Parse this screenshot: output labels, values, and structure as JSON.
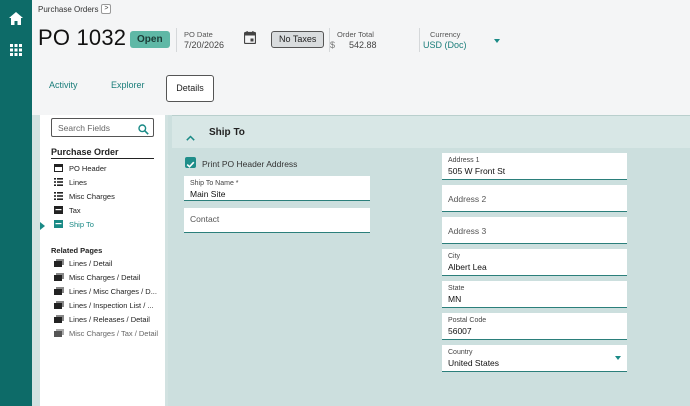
{
  "breadcrumb": {
    "label": "Purchase Orders",
    "button": ">"
  },
  "header": {
    "title": "PO 1032",
    "status": "Open",
    "po_date_label": "PO Date",
    "po_date": "7/20/2026",
    "tax_button": "No Taxes",
    "order_total_label": "Order Total",
    "currency_symbol": "$",
    "order_total": "542.88",
    "currency_label": "Currency",
    "currency_value": "USD (Doc)"
  },
  "tabs": {
    "activity": "Activity",
    "explorer": "Explorer",
    "details": "Details"
  },
  "nav": {
    "search_placeholder": "Search Fields",
    "section_title": "Purchase Order",
    "items": [
      "PO Header",
      "Lines",
      "Misc Charges",
      "Tax",
      "Ship To"
    ],
    "related_title": "Related Pages",
    "related": [
      "Lines / Detail",
      "Misc Charges / Detail",
      "Lines / Misc Charges / D...",
      "Lines / Inspection List / ...",
      "Lines / Releases / Detail",
      "Misc Charges / Tax / Detail"
    ]
  },
  "ship_to": {
    "section_title": "Ship To",
    "print_header_label": "Print PO Header Address",
    "ship_to_name_label": "Ship To Name *",
    "ship_to_name": "Main Site",
    "contact_placeholder": "Contact",
    "address1_label": "Address 1",
    "address1": "505 W Front St",
    "address2_placeholder": "Address 2",
    "address3_placeholder": "Address 3",
    "city_label": "City",
    "city": "Albert Lea",
    "state_label": "State",
    "state": "MN",
    "postal_label": "Postal Code",
    "postal": "56007",
    "country_label": "Country",
    "country": "United States"
  },
  "colors": {
    "brand": "#0d6b68",
    "accent": "#1a8a86",
    "status_open": "#5fb8a6",
    "panel": "#ccdfde"
  },
  "icons": [
    "home-icon",
    "apps-grid-icon",
    "calendar-icon",
    "search-icon",
    "chevron-up-icon",
    "checkbox-checked-icon",
    "dropdown-caret-icon"
  ]
}
